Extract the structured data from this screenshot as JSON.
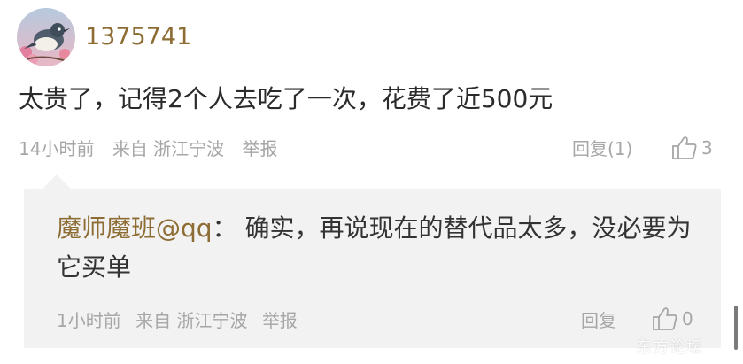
{
  "comment": {
    "username": "1375741",
    "text": "太贵了，记得2个人去吃了一次，花费了近500元",
    "time": "14小时前",
    "source": "来自 浙江宁波",
    "report_label": "举报",
    "reply_label": "回复(1)",
    "like_count": "3"
  },
  "reply": {
    "author": "魔师魔班@qq",
    "separator": "：",
    "text": "确实，再说现在的替代品太多，没必要为它买单",
    "time": "1小时前",
    "source": "来自 浙江宁波",
    "report_label": "举报",
    "reply_label": "回复",
    "like_count": "0"
  },
  "watermark": "东方论坛",
  "colors": {
    "username": "#8e6d35",
    "meta": "#a6a6a6",
    "reply_background": "#f2f2f2",
    "text": "#2b2b2b"
  },
  "icons": {
    "avatar": "bird-avatar",
    "like": "thumbs-up-icon"
  }
}
